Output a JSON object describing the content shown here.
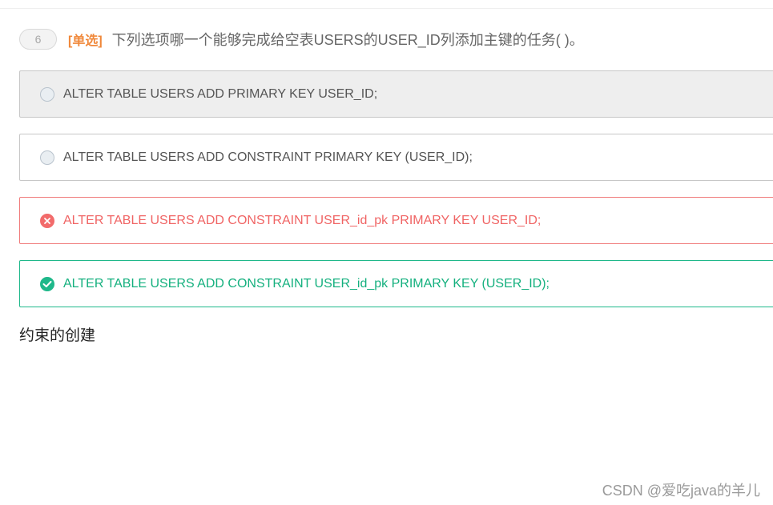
{
  "question": {
    "number": "6",
    "type_label": "[单选]",
    "text": "下列选项哪一个能够完成给空表USERS的USER_ID列添加主键的任务(  )。"
  },
  "options": [
    {
      "text": "ALTER TABLE USERS ADD PRIMARY KEY USER_ID;",
      "state": "unselected-highlighted"
    },
    {
      "text": "ALTER TABLE USERS ADD CONSTRAINT PRIMARY KEY (USER_ID);",
      "state": "unselected"
    },
    {
      "text": "ALTER TABLE USERS ADD CONSTRAINT USER_id_pk PRIMARY KEY USER_ID;",
      "state": "wrong",
      "icon": "x-circle-icon"
    },
    {
      "text": "ALTER TABLE USERS ADD CONSTRAINT USER_id_pk PRIMARY KEY (USER_ID);",
      "state": "correct",
      "icon": "check-circle-icon"
    }
  ],
  "note": "约束的创建",
  "watermark": "CSDN @爱吃java的羊儿",
  "colors": {
    "type_label": "#f0883a",
    "wrong": "#f06464",
    "correct": "#14b07e"
  }
}
